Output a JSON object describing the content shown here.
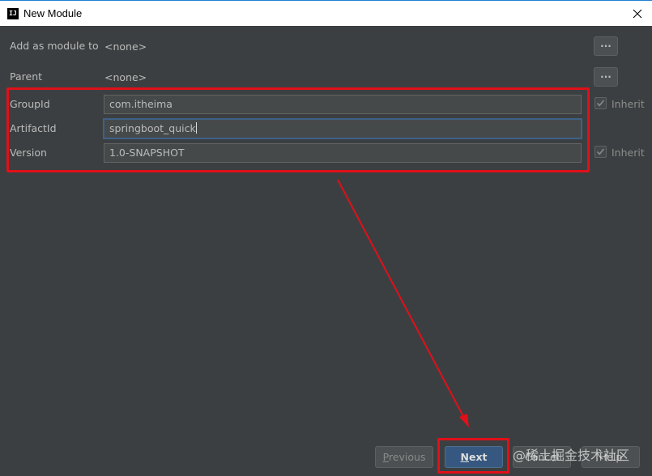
{
  "window": {
    "title": "New Module",
    "app_icon": "IJ"
  },
  "form": {
    "add_as_module_to": {
      "label": "Add as module to",
      "value": "<none>",
      "button": "..."
    },
    "parent": {
      "label": "Parent",
      "value": "<none>",
      "button": "..."
    },
    "group_id": {
      "label": "GroupId",
      "value": "com.itheima",
      "inherit_label": "Inherit",
      "inherit_checked": true
    },
    "artifact_id": {
      "label": "ArtifactId",
      "value": "springboot_quick"
    },
    "version": {
      "label": "Version",
      "value": "1.0-SNAPSHOT",
      "inherit_label": "Inherit",
      "inherit_checked": true
    }
  },
  "footer": {
    "previous": {
      "mnemonic": "P",
      "rest": "revious"
    },
    "next": {
      "mnemonic": "N",
      "rest": "ext"
    },
    "cancel": "Cancel",
    "help": "Help"
  },
  "watermark": "@稀土掘金技术社区",
  "annotation_color": "#e0101a",
  "accent_color": "#365880"
}
